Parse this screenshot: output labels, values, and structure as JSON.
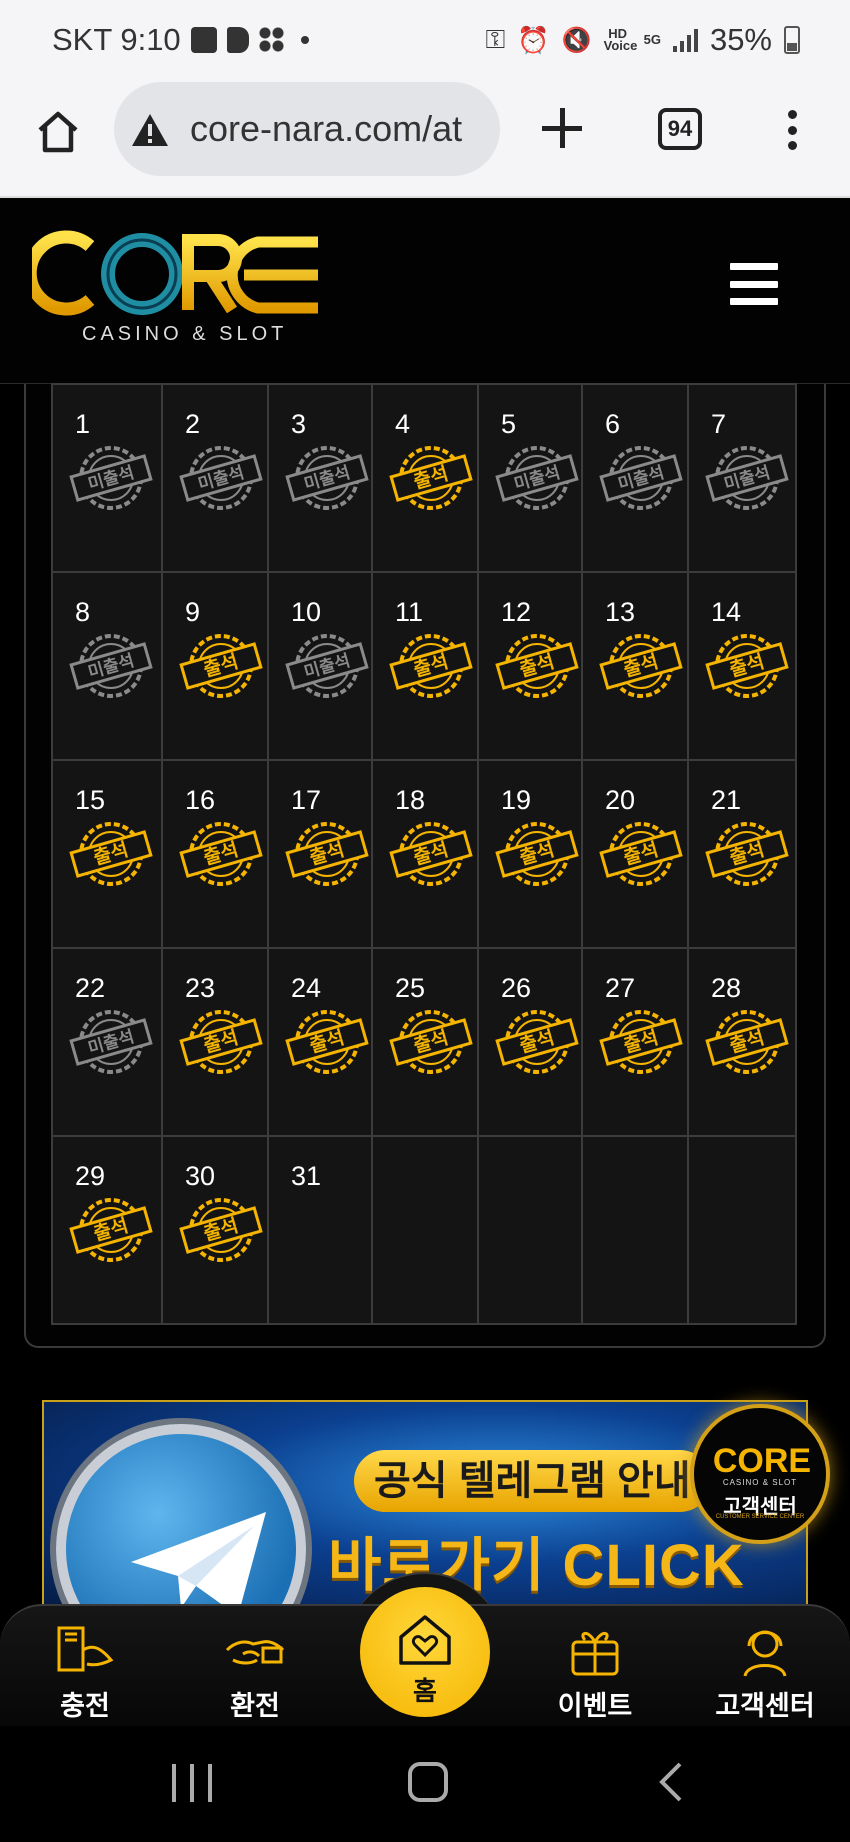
{
  "status_bar": {
    "carrier_time": "SKT 9:10",
    "hd_voice": "HD Voice",
    "network": "5G",
    "battery": "35%"
  },
  "browser": {
    "url": "core-nara.com/at",
    "tab_count": "94"
  },
  "site": {
    "logo_text": "CORE",
    "logo_sub": "CASINO & SLOT"
  },
  "calendar": {
    "stamp_attended": "출석",
    "stamp_absent": "미출석",
    "days": [
      {
        "num": "1",
        "status": "absent"
      },
      {
        "num": "2",
        "status": "absent"
      },
      {
        "num": "3",
        "status": "absent"
      },
      {
        "num": "4",
        "status": "attended"
      },
      {
        "num": "5",
        "status": "absent"
      },
      {
        "num": "6",
        "status": "absent"
      },
      {
        "num": "7",
        "status": "absent"
      },
      {
        "num": "8",
        "status": "absent"
      },
      {
        "num": "9",
        "status": "attended"
      },
      {
        "num": "10",
        "status": "absent"
      },
      {
        "num": "11",
        "status": "attended"
      },
      {
        "num": "12",
        "status": "attended"
      },
      {
        "num": "13",
        "status": "attended"
      },
      {
        "num": "14",
        "status": "attended"
      },
      {
        "num": "15",
        "status": "attended"
      },
      {
        "num": "16",
        "status": "attended"
      },
      {
        "num": "17",
        "status": "attended"
      },
      {
        "num": "18",
        "status": "attended"
      },
      {
        "num": "19",
        "status": "attended"
      },
      {
        "num": "20",
        "status": "attended"
      },
      {
        "num": "21",
        "status": "attended"
      },
      {
        "num": "22",
        "status": "absent"
      },
      {
        "num": "23",
        "status": "attended"
      },
      {
        "num": "24",
        "status": "attended"
      },
      {
        "num": "25",
        "status": "attended"
      },
      {
        "num": "26",
        "status": "attended"
      },
      {
        "num": "27",
        "status": "attended"
      },
      {
        "num": "28",
        "status": "attended"
      },
      {
        "num": "29",
        "status": "attended"
      },
      {
        "num": "30",
        "status": "attended"
      },
      {
        "num": "31",
        "status": "none"
      },
      {
        "num": "",
        "status": "empty"
      },
      {
        "num": "",
        "status": "empty"
      },
      {
        "num": "",
        "status": "empty"
      },
      {
        "num": "",
        "status": "empty"
      }
    ]
  },
  "banner": {
    "top_text": "공식 텔레그램 안내",
    "bottom_text": "바로가기 CLICK"
  },
  "customer_float": {
    "logo": "CORE",
    "sub": "CASINO & SLOT",
    "title": "고객센터",
    "sub2": "CUSTOMER SERVICE CENTER"
  },
  "bottom_nav": {
    "deposit": "충전",
    "withdraw": "환전",
    "home": "홈",
    "event": "이벤트",
    "support": "고객센터"
  },
  "colors": {
    "gold": "#f5b400",
    "gray_stamp": "#8a8a8a"
  }
}
